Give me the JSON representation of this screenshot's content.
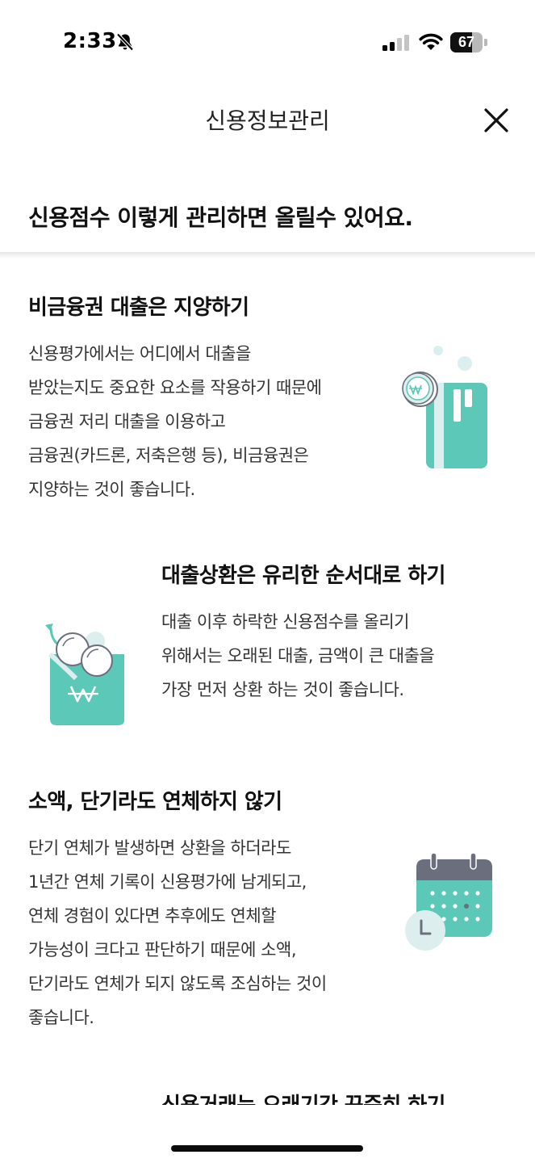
{
  "status_bar": {
    "time": "2:33",
    "battery_level": "67",
    "battery_fraction": 0.67,
    "icons": [
      "bell-slash-icon",
      "cellular-signal-icon",
      "wifi-icon",
      "battery-icon"
    ]
  },
  "nav": {
    "title": "신용정보관리",
    "close_icon": "close-icon"
  },
  "headline": "신용점수 이렇게 관리하면 올릴수 있어요.",
  "sections": [
    {
      "title": "비금융권 대출은 지양하기",
      "body": [
        "신용평가에서는 어디에서 대출을",
        "받았는지도 중요한 요소를 작용하기 때문에",
        "금융권 저리 대출을 이용하고",
        "금융권(카드론, 저축은행 등), 비금융권은",
        "지양하는 것이 좋습니다."
      ],
      "icon": "card-coin-icon"
    },
    {
      "title": "대출상환은 유리한 순서대로 하기",
      "body": [
        "대출 이후 하락한 신용점수를 올리기",
        "위해서는 오래된 대출, 금액이 큰 대출을",
        "가장 먼저 상환 하는 것이 좋습니다."
      ],
      "icon": "money-pouch-icon"
    },
    {
      "title": "소액, 단기라도 연체하지 않기",
      "body": [
        "단기 연체가 발생하면 상환을 하더라도",
        "1년간 연체 기록이 신용평가에 남게되고,",
        "연체 경험이 있다면 추후에도 연체할",
        "가능성이 크다고 판단하기 때문에 소액,",
        "단기라도 연체가 되지 않도록 조심하는 것이",
        "좋습니다."
      ],
      "icon": "calendar-clock-icon"
    },
    {
      "title": "신용거래는 오래기간 꾸준히 하기"
    }
  ],
  "colors": {
    "teal": "#5bc8b8",
    "teal_light": "#dcefee",
    "gray_bar": "#6b6f7d",
    "text_dark": "#111111",
    "text_body": "#333333"
  }
}
